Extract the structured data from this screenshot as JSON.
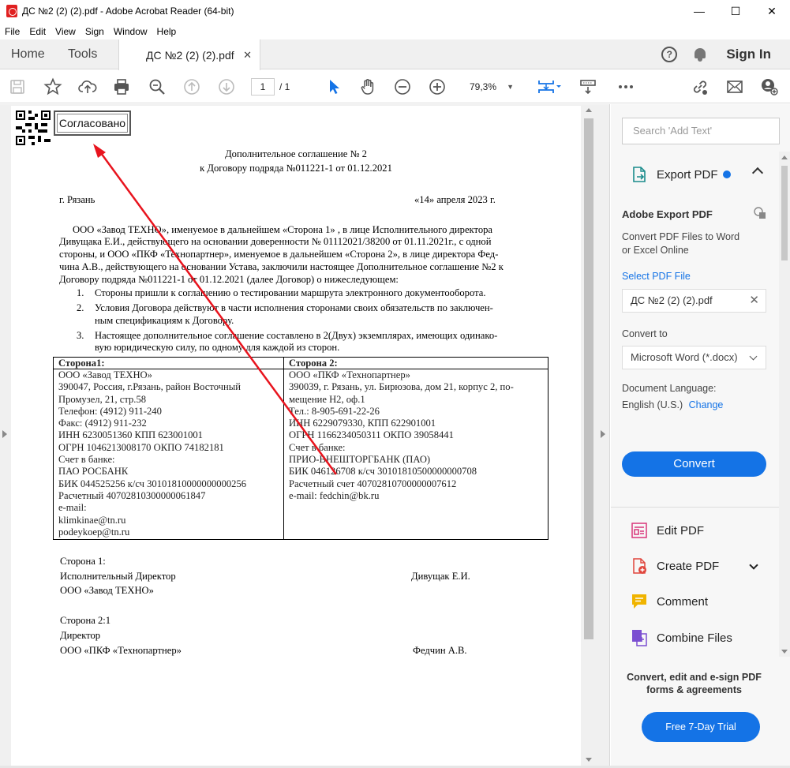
{
  "window": {
    "title": "ДС №2 (2) (2).pdf - Adobe Acrobat Reader (64-bit)",
    "minimize": "—",
    "maximize": "☐",
    "close": "✕"
  },
  "menu": [
    "File",
    "Edit",
    "View",
    "Sign",
    "Window",
    "Help"
  ],
  "tabs": {
    "home": "Home",
    "tools": "Tools",
    "doc": "ДС №2 (2) (2).pdf",
    "doc_close": "✕",
    "signin": "Sign In",
    "help": "?"
  },
  "toolbar": {
    "page_current": "1",
    "page_total": "/ 1",
    "zoom": "79,3%",
    "accent": "#1473e6"
  },
  "document": {
    "stamp": "Согласовано",
    "title1": "Дополнительное соглашение № 2",
    "title2": "к Договору подряда №011221-1 от 01.12.2021",
    "city": "г. Рязань",
    "date": "«14» апреля  2023 г.",
    "para": [
      "ООО «Завод ТЕХНО», именуемое в дальнейшем  «Сторона 1» , в лице Исполнительного директора",
      "Дивущака Е.И., действующего на основании доверенности № 01112021/38200 от 01.11.2021г., с одной",
      "стороны, и ООО «ПКФ «Технопартнер», именуемое  в дальнейшем «Сторона 2», в лице директора Фед-",
      "чина А.В., действующего на основании Устава, заключили настоящее Дополнительное соглашение №2 к",
      "Договору подряда №011221-1 от 01.12.2021 (далее Договор) о нижеследующем:"
    ],
    "items": [
      {
        "n": "1.",
        "lines": [
          "Стороны пришли к соглашению о тестировании маршрута электронного документооборота."
        ]
      },
      {
        "n": "2.",
        "lines": [
          "Условия Договора действуют в части исполнения сторонами своих обязательств по заключен-",
          "ным спецификациям к Договору."
        ]
      },
      {
        "n": "3.",
        "lines": [
          "Настоящее дополнительное соглашение составлено в 2(Двух) экземплярах, имеющих одинако-",
          "вую юридическую силу, по одному для каждой из сторон."
        ]
      }
    ],
    "table": {
      "left_header": "Сторона1:",
      "right_header": "Сторона 2:",
      "left": [
        "ООО «Завод ТЕХНО»",
        "390047, Россия, г.Рязань, район Восточный",
        "Промузел, 21, стр.58",
        "Телефон: (4912) 911-240",
        "Факс: (4912) 911-232",
        "ИНН 6230051360     КПП 623001001",
        "ОГРН 1046213008170   ОКПО 74182181",
        "Счет в банке:",
        "ПАО РОСБАНК",
        "БИК 044525256  к/сч 30101810000000000256",
        "Расчетный 40702810300000061847",
        "e-mail:",
        "klimkinae@tn.ru",
        "podeykoep@tn.ru"
      ],
      "right": [
        "ООО «ПКФ «Технопартнер»",
        "390039, г. Рязань, ул. Бирюзова, дом 21, корпус 2, по-",
        "мещение Н2, оф.1",
        "Тел.: 8-905-691-22-26",
        "ИНН 6229079330, КПП 622901001",
        "ОГРН 1166234050311  ОКПО 39058441",
        "Счет в банке:",
        "ПРИО-ВНЕШТОРГБАНК (ПАО)",
        "БИК 046126708 к/сч  30101810500000000708",
        "Расчетный  счет 40702810700000007612",
        "e-mail: fedchin@bk.ru"
      ]
    },
    "sign1_label": "Сторона 1:",
    "sign1_role": "Исполнительный Директор",
    "sign1_name": "Дивущак Е.И.",
    "sign1_org": "ООО «Завод ТЕХНО»",
    "sign2_label": "Сторона 2:1",
    "sign2_role": "Директор",
    "sign2_org": "ООО «ПКФ «Технопартнер»",
    "sign2_name": "Федчин А.В."
  },
  "panel": {
    "search_placeholder": "Search 'Add Text'",
    "export_title": "Export PDF",
    "adobe_export": "Adobe Export PDF",
    "desc1": "Convert PDF Files to Word",
    "desc2": "or Excel Online",
    "select_pdf": "Select PDF File",
    "file_name": "ДС №2 (2) (2).pdf",
    "file_clear": "✕",
    "convert_to": "Convert to",
    "format": "Microsoft Word (*.docx)",
    "doc_lang": "Document Language:",
    "lang": "English (U.S.)",
    "change": "Change",
    "convert": "Convert",
    "tools": [
      "Edit PDF",
      "Create PDF",
      "Comment",
      "Combine Files"
    ],
    "promo1": "Convert, edit and e-sign PDF",
    "promo2": "forms & agreements",
    "trial": "Free 7-Day Trial"
  },
  "colors": {
    "accent": "#1473e6",
    "annotation_arrow": "#e8141e"
  }
}
